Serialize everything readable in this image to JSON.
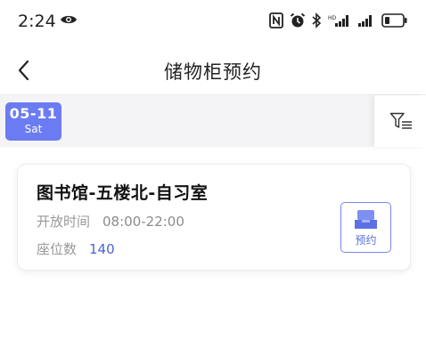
{
  "status_bar": {
    "time": "2:24",
    "icons": [
      "eye-icon",
      "nfc-icon",
      "alarm-icon",
      "bluetooth-icon",
      "signal-icon",
      "signal-icon",
      "battery-icon"
    ]
  },
  "nav": {
    "title": "储物柜预约",
    "back_icon": "chevron-left-icon"
  },
  "date_selector": {
    "selected_date": "05-11",
    "selected_weekday": "Sat",
    "filter_icon": "filter-icon",
    "accent_color": "#6b7cf2"
  },
  "locker": {
    "title": "图书馆-五楼北-自习室",
    "hours_label": "开放时间",
    "hours_value": "08:00-22:00",
    "seats_label": "座位数",
    "seats_value": "140",
    "reserve_label": "预约",
    "reserve_icon": "locker-icon"
  }
}
